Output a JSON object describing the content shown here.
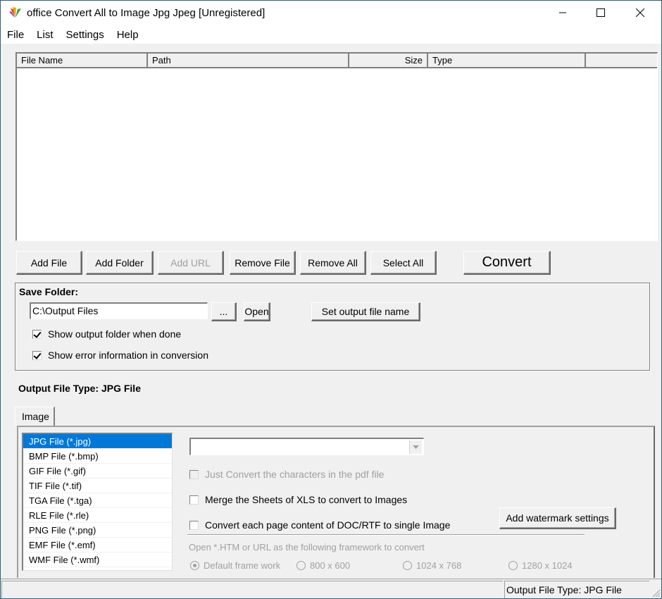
{
  "window": {
    "title": "office Convert All to Image Jpg Jpeg [Unregistered]",
    "controls": [
      "minimize",
      "maximize",
      "close"
    ]
  },
  "menu": {
    "items": [
      {
        "label": "File"
      },
      {
        "label": "List"
      },
      {
        "label": "Settings"
      },
      {
        "label": "Help"
      }
    ]
  },
  "file_list": {
    "columns": [
      {
        "label": "File Name"
      },
      {
        "label": "Path"
      },
      {
        "label": "Size"
      },
      {
        "label": "Type"
      },
      {
        "label": ""
      }
    ],
    "rows": []
  },
  "toolbar": {
    "add_file": "Add File",
    "add_folder": "Add Folder",
    "add_url": "Add URL",
    "remove_file": "Remove File",
    "remove_all": "Remove All",
    "select_all": "Select All",
    "convert": "Convert"
  },
  "save_folder": {
    "title": "Save Folder:",
    "path_value": "C:\\Output Files",
    "browse_label": "...",
    "open_label": "Open",
    "set_output_name_label": "Set output file name",
    "show_output_folder": {
      "label": "Show output folder when done",
      "checked": true
    },
    "show_error_info": {
      "label": "Show error information in conversion",
      "checked": true
    }
  },
  "output_type": {
    "label": "Output File Type:  JPG File"
  },
  "tabs": [
    {
      "label": "Image",
      "active": true
    }
  ],
  "image_types": {
    "selected_index": 0,
    "items": [
      {
        "label": "JPG File  (*.jpg)"
      },
      {
        "label": "BMP File  (*.bmp)"
      },
      {
        "label": "GIF File  (*.gif)"
      },
      {
        "label": "TIF File  (*.tif)"
      },
      {
        "label": "TGA File  (*.tga)"
      },
      {
        "label": "RLE File  (*.rle)"
      },
      {
        "label": "PNG File  (*.png)"
      },
      {
        "label": "EMF File  (*.emf)"
      },
      {
        "label": "WMF File  (*.wmf)"
      }
    ]
  },
  "options": {
    "combo_value": "",
    "just_convert_chars": {
      "label": "Just Convert the characters in the pdf file",
      "checked": false,
      "enabled": false
    },
    "merge_sheets": {
      "label": "Merge the Sheets of XLS to convert to Images",
      "checked": false,
      "enabled": true
    },
    "convert_each_page": {
      "label": "Convert each page content of DOC/RTF to single Image",
      "checked": false,
      "enabled": true
    },
    "watermark_button": "Add watermark settings",
    "framework_label": "Open *.HTM or URL as the following framework to convert",
    "framework_options": [
      {
        "label": "Default frame work",
        "selected": true
      },
      {
        "label": "800 x 600",
        "selected": false
      },
      {
        "label": "1024 x 768",
        "selected": false
      },
      {
        "label": "1280 x 1024",
        "selected": false
      }
    ]
  },
  "status": {
    "left": "",
    "right": "Output File Type:  JPG File"
  }
}
